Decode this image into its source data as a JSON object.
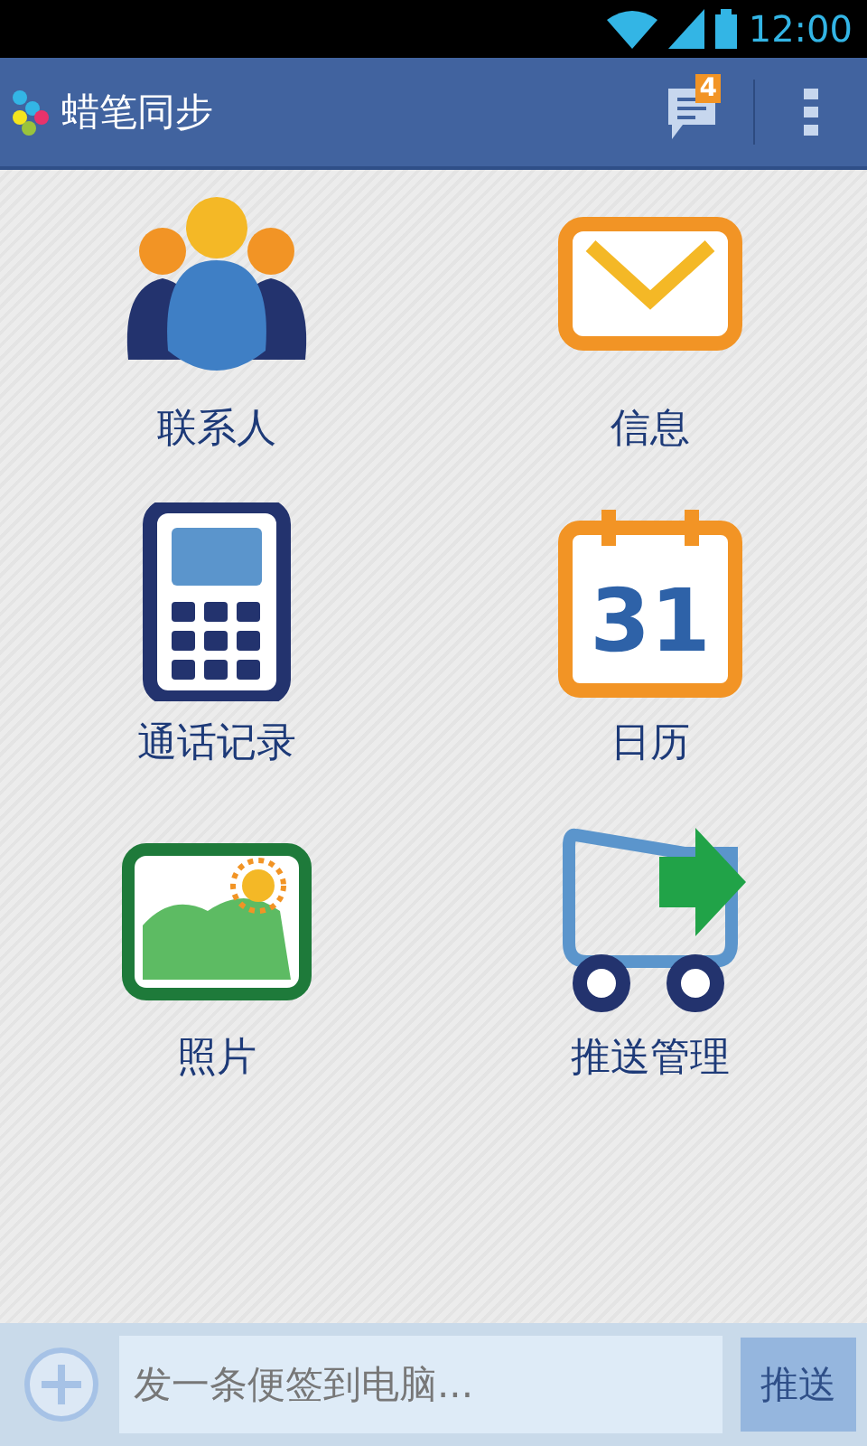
{
  "status_bar": {
    "time": "12:00"
  },
  "action_bar": {
    "title": "蜡笔同步",
    "notification_count": "4"
  },
  "tiles": [
    {
      "kind": "contacts",
      "label": "联系人"
    },
    {
      "kind": "message",
      "label": "信息"
    },
    {
      "kind": "phone",
      "label": "通话记录"
    },
    {
      "kind": "calendar",
      "label": "日历"
    },
    {
      "kind": "photo",
      "label": "照片"
    },
    {
      "kind": "push",
      "label": "推送管理"
    }
  ],
  "calendar_icon": {
    "day": "31"
  },
  "composer": {
    "placeholder": "发一条便签到电脑...",
    "send_button": "推送"
  }
}
